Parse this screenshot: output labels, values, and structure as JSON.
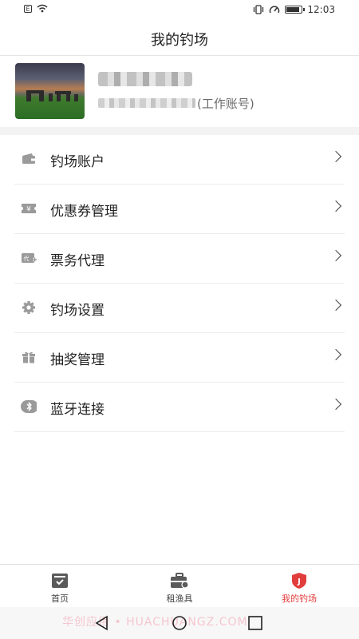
{
  "status_bar": {
    "time": "12:03"
  },
  "header": {
    "title": "我的钓场"
  },
  "profile": {
    "work_account_label": "(工作账号)"
  },
  "menu": [
    {
      "label": "钓场账户",
      "icon": "wallet-icon"
    },
    {
      "label": "优惠券管理",
      "icon": "coupon-icon"
    },
    {
      "label": "票务代理",
      "icon": "ticket-icon"
    },
    {
      "label": "钓场设置",
      "icon": "gear-icon"
    },
    {
      "label": "抽奖管理",
      "icon": "gift-icon"
    },
    {
      "label": "蓝牙连接",
      "icon": "bluetooth-icon"
    }
  ],
  "bottom_nav": [
    {
      "label": "首页",
      "icon": "home-box-icon",
      "active": false
    },
    {
      "label": "租渔具",
      "icon": "toolbox-icon",
      "active": false
    },
    {
      "label": "我的钓场",
      "icon": "shield-j-icon",
      "active": true
    }
  ],
  "system_nav": {
    "watermark": "华创应用 • HUACHUANGZ.COM"
  },
  "colors": {
    "accent": "#e23d3d",
    "icon_gray": "#8f8f8f",
    "divider": "#ececec"
  }
}
